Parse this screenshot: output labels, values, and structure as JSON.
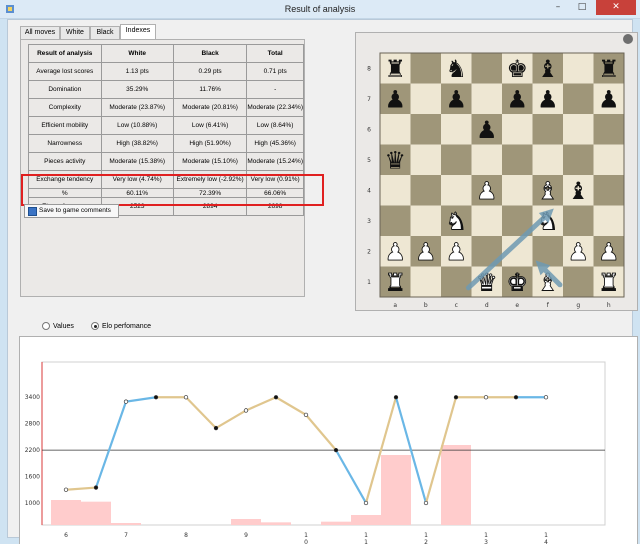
{
  "window": {
    "title": "Result of analysis",
    "minimize": "–",
    "maximize": "□",
    "close": "✕"
  },
  "tabs": [
    {
      "label": "All moves",
      "active": false
    },
    {
      "label": "White",
      "active": false
    },
    {
      "label": "Black",
      "active": false
    },
    {
      "label": "Indexes",
      "active": true
    }
  ],
  "table": {
    "headers": [
      "Result of analysis",
      "White",
      "Black",
      "Total"
    ],
    "rows": [
      [
        "Average lost scores",
        "1.13 pts",
        "0.29 pts",
        "0.71 pts"
      ],
      [
        "Domination",
        "35.29%",
        "11.76%",
        "-"
      ],
      [
        "Complexity",
        "Moderate (23.87%)",
        "Moderate (20.81%)",
        "Moderate (22.34%)"
      ],
      [
        "Efficient mobility",
        "Low (10.88%)",
        "Low (6.41%)",
        "Low (8.64%)"
      ],
      [
        "Narrowness",
        "High (38.82%)",
        "High (51.90%)",
        "High (45.36%)"
      ],
      [
        "Pieces activity",
        "Moderate (15.38%)",
        "Moderate (15.10%)",
        "Moderate (15.24%)"
      ],
      [
        "Exchange tendency",
        "Very low (4.74%)",
        "Extremely low (-2.92%)",
        "Very low (0.91%)"
      ],
      [
        "%",
        "60.11%",
        "72.39%",
        "66.06%"
      ],
      [
        "Elo perfomance",
        "2523",
        "2894",
        "2698"
      ]
    ]
  },
  "save_button": "Save to game comments",
  "board": {
    "files": [
      "a",
      "b",
      "c",
      "d",
      "e",
      "f",
      "g",
      "h"
    ],
    "ranks": [
      "8",
      "7",
      "6",
      "5",
      "4",
      "3",
      "2",
      "1"
    ],
    "light_color": "#eee7d3",
    "dark_color": "#9f9679",
    "arrow_color": "#6e9ab3",
    "position": [
      [
        "r",
        "",
        "n",
        "",
        "k",
        "b",
        "",
        "r"
      ],
      [
        "p",
        "",
        "p",
        "",
        "p",
        "p",
        "",
        "p"
      ],
      [
        "",
        "",
        "",
        "p",
        "",
        "",
        "",
        ""
      ],
      [
        "q",
        "",
        "",
        "",
        "",
        "",
        "",
        ""
      ],
      [
        "",
        "",
        "",
        "P",
        "",
        "B",
        "b",
        ""
      ],
      [
        "",
        "",
        "N",
        "",
        "",
        "N",
        "",
        ""
      ],
      [
        "P",
        "P",
        "P",
        "",
        "",
        "",
        "P",
        "P"
      ],
      [
        "R",
        "",
        "",
        "Q",
        "K",
        "B",
        "",
        "R"
      ]
    ]
  },
  "radio": {
    "values": "Values",
    "elo": "Elo perfomance",
    "selected": "elo"
  },
  "chart_data": {
    "type": "line",
    "series": [
      {
        "values": [
          1300,
          1350,
          3300,
          3400,
          3400,
          2700,
          3100,
          3400,
          3000,
          2200,
          1000,
          3400,
          1000,
          3400,
          3400,
          3400,
          3400
        ]
      }
    ],
    "segment_colors": [
      "#e0c68e",
      "#6ab7e6",
      "#6ab7e6",
      "#e0c68e",
      "#e0c68e",
      "#e0c68e",
      "#e0c68e",
      "#e0c68e",
      "#e0c68e",
      "#6ab7e6",
      "#e0c68e",
      "#6ab7e6",
      "#e0c68e",
      "#e0c68e",
      "#e0c68e",
      "#6ab7e6"
    ],
    "bars": [
      0.75,
      0.7,
      0.06,
      0,
      0,
      0,
      0.18,
      0.08,
      0,
      0.1,
      0.3,
      2.1,
      0,
      2.4,
      0,
      0,
      0
    ],
    "bar_color": "#ffcccc",
    "reference_line": 2200,
    "ylim": [
      500,
      4200
    ],
    "yticks": [
      1000,
      1600,
      2200,
      2800,
      3400
    ],
    "xtick_labels": [
      {
        "index": 0,
        "text": "6"
      },
      {
        "index": 2,
        "text": "7"
      },
      {
        "index": 4,
        "text": "8"
      },
      {
        "index": 6,
        "text": "9"
      },
      {
        "index": 8,
        "text": "1\n0"
      },
      {
        "index": 10,
        "text": "1\n1"
      },
      {
        "index": 12,
        "text": "1\n2"
      },
      {
        "index": 14,
        "text": "1\n3"
      },
      {
        "index": 16,
        "text": "1\n4"
      }
    ]
  }
}
